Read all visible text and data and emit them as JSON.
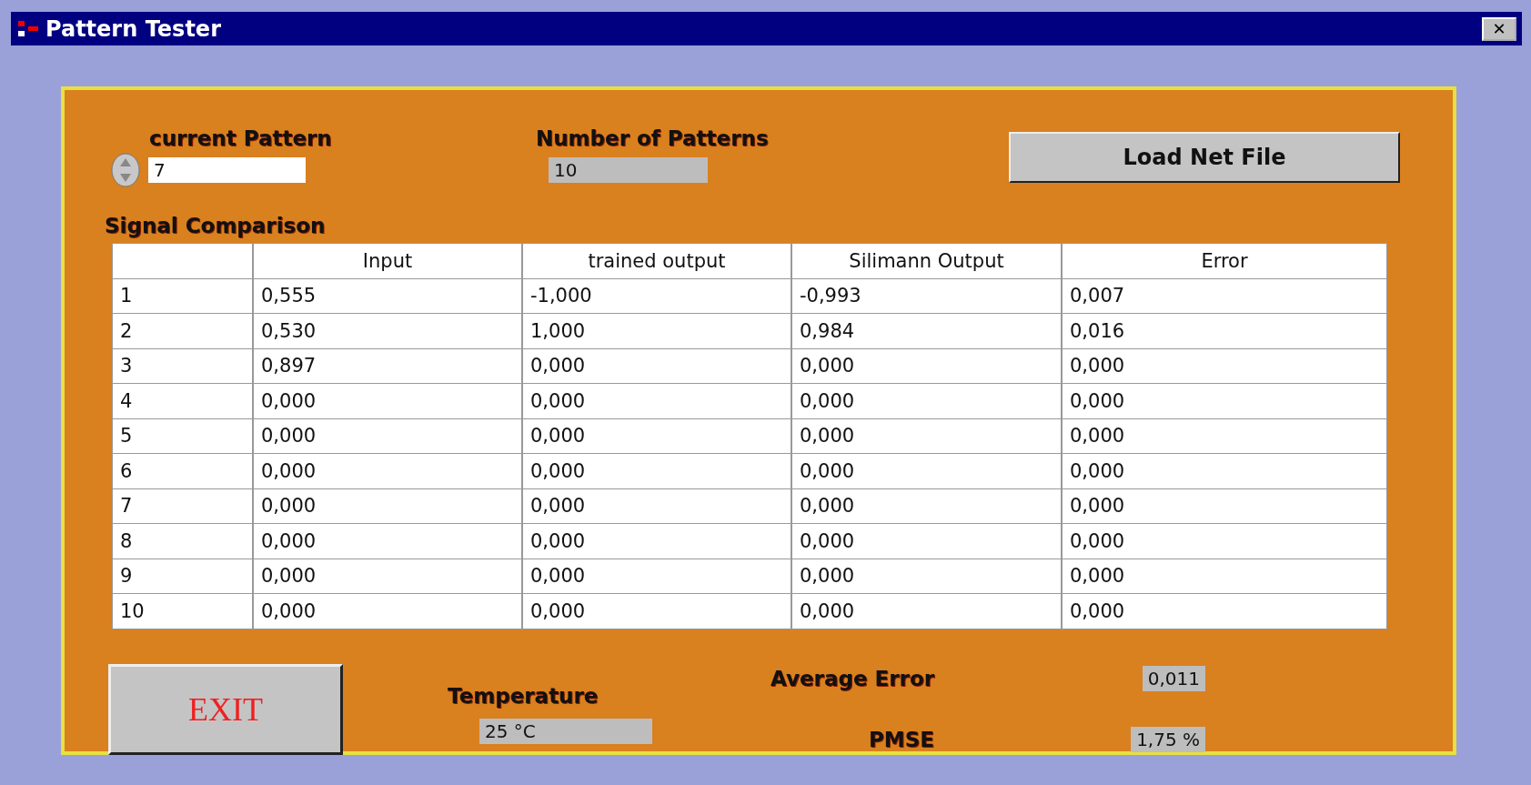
{
  "window": {
    "title": "Pattern Tester",
    "close": "✕"
  },
  "current_pattern": {
    "label": "current Pattern",
    "value": "7"
  },
  "number_of_patterns": {
    "label": "Number of Patterns",
    "value": "10"
  },
  "load_button": "Load Net File",
  "table": {
    "title": "Signal Comparison",
    "columns": [
      "",
      "Input",
      "trained output",
      "Silimann Output",
      "Error"
    ],
    "rows": [
      [
        "1",
        "0,555",
        "-1,000",
        "-0,993",
        "0,007"
      ],
      [
        "2",
        "0,530",
        "1,000",
        "0,984",
        "0,016"
      ],
      [
        "3",
        "0,897",
        "0,000",
        "0,000",
        "0,000"
      ],
      [
        "4",
        "0,000",
        "0,000",
        "0,000",
        "0,000"
      ],
      [
        "5",
        "0,000",
        "0,000",
        "0,000",
        "0,000"
      ],
      [
        "6",
        "0,000",
        "0,000",
        "0,000",
        "0,000"
      ],
      [
        "7",
        "0,000",
        "0,000",
        "0,000",
        "0,000"
      ],
      [
        "8",
        "0,000",
        "0,000",
        "0,000",
        "0,000"
      ],
      [
        "9",
        "0,000",
        "0,000",
        "0,000",
        "0,000"
      ],
      [
        "10",
        "0,000",
        "0,000",
        "0,000",
        "0,000"
      ]
    ]
  },
  "exit_button": "EXIT",
  "temperature": {
    "label": "Temperature",
    "value": "25 °C"
  },
  "average_error": {
    "label": "Average Error",
    "value": "0,011"
  },
  "pmse": {
    "label": "PMSE",
    "value": "1,75 %"
  }
}
